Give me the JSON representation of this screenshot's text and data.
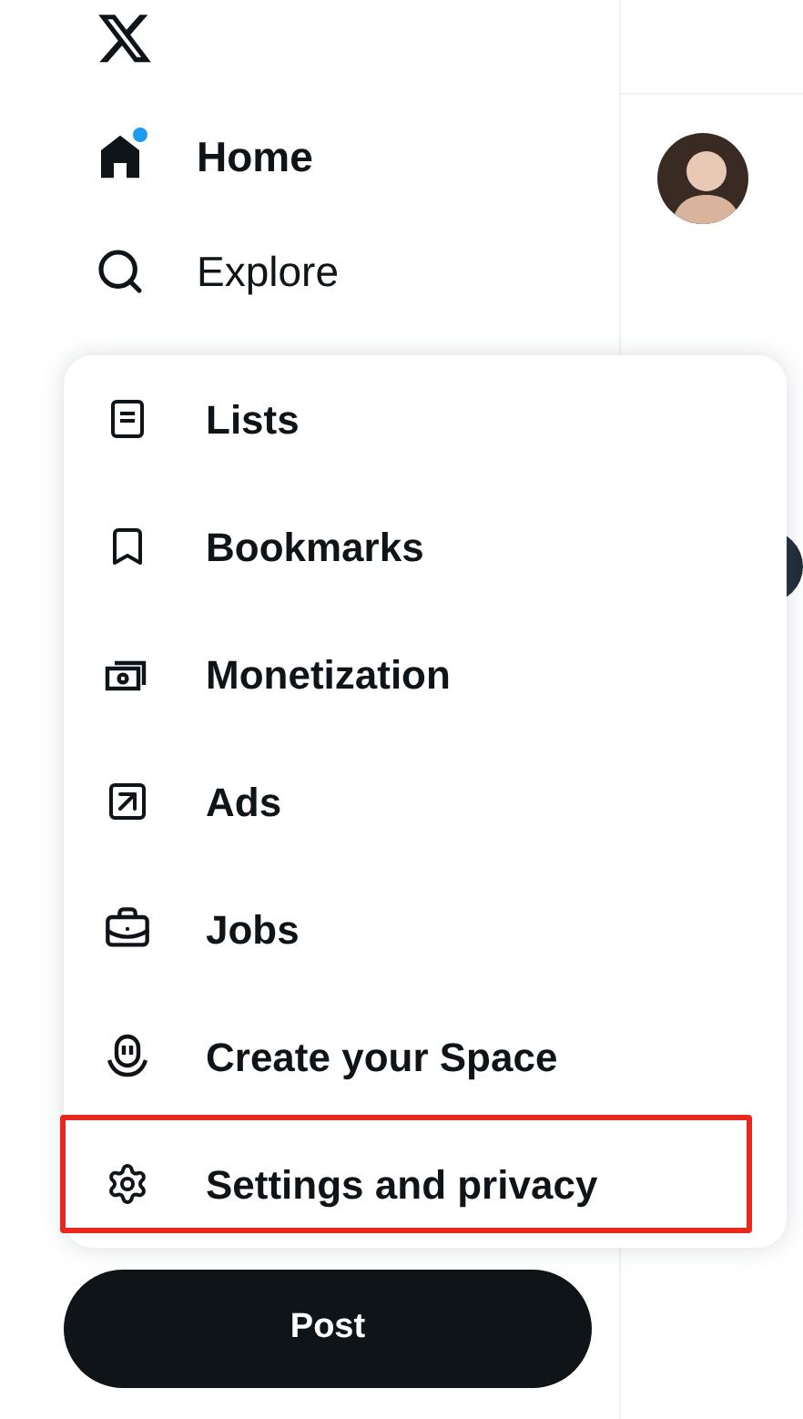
{
  "nav": [
    {
      "label": "Home",
      "kind": "home",
      "selected": true,
      "notification": true
    },
    {
      "label": "Explore",
      "kind": "search",
      "selected": false,
      "notification": false
    }
  ],
  "menu": {
    "items": [
      {
        "label": "Lists",
        "kind": "lists",
        "highlighted": false
      },
      {
        "label": "Bookmarks",
        "kind": "bookmarks",
        "highlighted": false
      },
      {
        "label": "Monetization",
        "kind": "money",
        "highlighted": false
      },
      {
        "label": "Ads",
        "kind": "ads",
        "highlighted": false
      },
      {
        "label": "Jobs",
        "kind": "jobs",
        "highlighted": false
      },
      {
        "label": "Create your Space",
        "kind": "space",
        "highlighted": false
      },
      {
        "label": "Settings and privacy",
        "kind": "settings",
        "highlighted": true
      }
    ]
  },
  "post_button": "Post"
}
